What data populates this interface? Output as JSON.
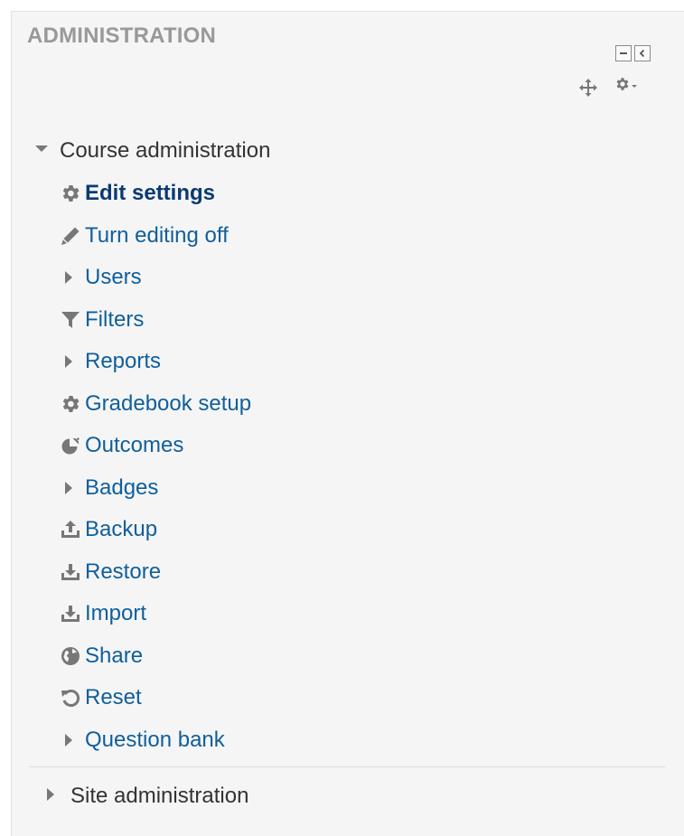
{
  "block": {
    "title": "ADMINISTRATION",
    "controls": [
      "minimize-icon",
      "dock-icon"
    ],
    "move_icon": "move-arrows-icon",
    "actions_icon": "gear-icon"
  },
  "course_admin": {
    "label": "Course administration",
    "expanded": true,
    "items": [
      {
        "label": "Edit settings",
        "icon": "gear-icon",
        "type": "link",
        "active": true
      },
      {
        "label": "Turn editing off",
        "icon": "pencil-icon",
        "type": "link"
      },
      {
        "label": "Users",
        "icon": "caret-right-icon",
        "type": "branch"
      },
      {
        "label": "Filters",
        "icon": "filter-icon",
        "type": "link"
      },
      {
        "label": "Reports",
        "icon": "caret-right-icon",
        "type": "branch"
      },
      {
        "label": "Gradebook setup",
        "icon": "gear-icon",
        "type": "link"
      },
      {
        "label": "Outcomes",
        "icon": "outcomes-icon",
        "type": "link"
      },
      {
        "label": "Badges",
        "icon": "caret-right-icon",
        "type": "branch"
      },
      {
        "label": "Backup",
        "icon": "upload-icon",
        "type": "link"
      },
      {
        "label": "Restore",
        "icon": "download-icon",
        "type": "link"
      },
      {
        "label": "Import",
        "icon": "download-icon",
        "type": "link"
      },
      {
        "label": "Share",
        "icon": "globe-icon",
        "type": "link"
      },
      {
        "label": "Reset",
        "icon": "reset-icon",
        "type": "link"
      },
      {
        "label": "Question bank",
        "icon": "caret-right-icon",
        "type": "branch"
      }
    ]
  },
  "site_admin": {
    "label": "Site administration",
    "expanded": false
  },
  "colors": {
    "link": "#0f5f9c",
    "active_link": "#0a3a73",
    "heading": "#999999",
    "text": "#333333",
    "icon": "#777777",
    "background": "#f5f5f5"
  }
}
